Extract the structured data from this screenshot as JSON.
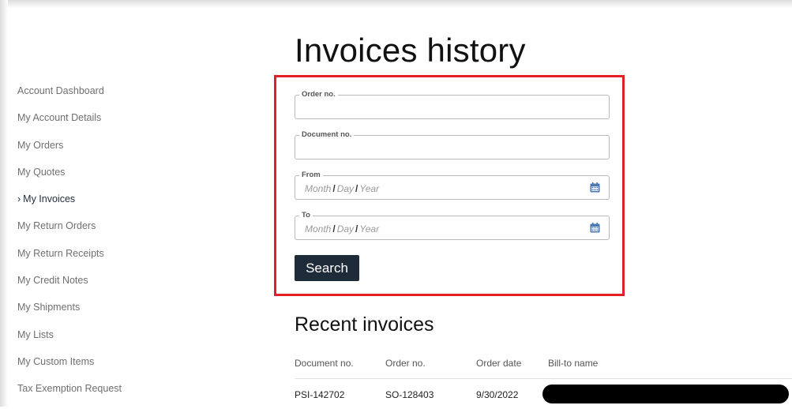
{
  "sidebar": {
    "items": [
      {
        "label": "Account Dashboard",
        "active": false
      },
      {
        "label": "My Account Details",
        "active": false
      },
      {
        "label": "My Orders",
        "active": false
      },
      {
        "label": "My Quotes",
        "active": false
      },
      {
        "label": "My Invoices",
        "active": true,
        "prefix": "›"
      },
      {
        "label": "My Return Orders",
        "active": false
      },
      {
        "label": "My Return Receipts",
        "active": false
      },
      {
        "label": "My Credit Notes",
        "active": false
      },
      {
        "label": "My Shipments",
        "active": false
      },
      {
        "label": "My Lists",
        "active": false
      },
      {
        "label": "My Custom Items",
        "active": false
      },
      {
        "label": "Tax Exemption Request",
        "active": false
      }
    ]
  },
  "page": {
    "title": "Invoices history"
  },
  "filters": {
    "order_no": {
      "label": "Order no.",
      "value": ""
    },
    "document_no": {
      "label": "Document no.",
      "value": ""
    },
    "from": {
      "label": "From",
      "month": "Month",
      "day": "Day",
      "year": "Year",
      "sep": "/"
    },
    "to": {
      "label": "To",
      "month": "Month",
      "day": "Day",
      "year": "Year",
      "sep": "/"
    },
    "search_label": "Search"
  },
  "recent": {
    "title": "Recent invoices",
    "columns": [
      "Document no.",
      "Order no.",
      "Order date",
      "Bill-to name"
    ],
    "rows": [
      {
        "document_no": "PSI-142702",
        "order_no": "SO-128403",
        "order_date": "9/30/2022",
        "bill_to_name": ""
      }
    ]
  },
  "colors": {
    "highlight": "#e21f26",
    "button": "#1e2b38",
    "calendar_icon": "#4a78b5"
  },
  "icons": {
    "chevron": "chevron-right-icon",
    "calendar": "calendar-icon"
  }
}
